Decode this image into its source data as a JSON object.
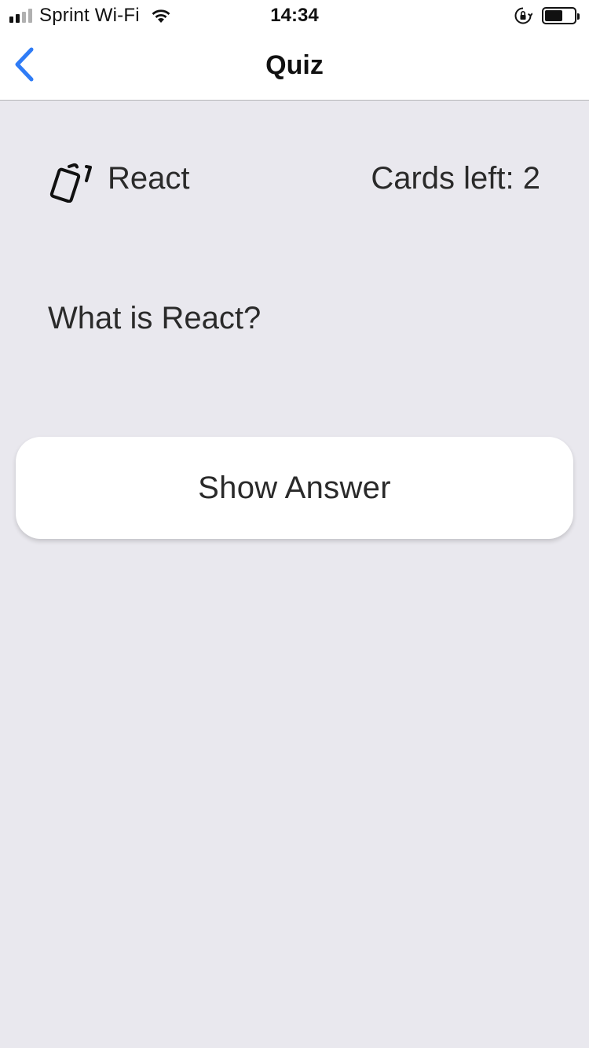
{
  "status_bar": {
    "carrier": "Sprint Wi-Fi",
    "time": "14:34",
    "signal_icon": "signal-bars-icon",
    "wifi_icon": "wifi-icon",
    "rotation_lock_icon": "rotation-lock-icon",
    "battery_icon": "battery-icon",
    "battery_level": 0.65
  },
  "nav": {
    "title": "Quiz",
    "back_icon": "chevron-left-icon",
    "accent_color": "#2f7cf6"
  },
  "deck": {
    "icon": "cards-icon",
    "name": "React",
    "cards_left_label": "Cards left: 2"
  },
  "card": {
    "question": "What is React?"
  },
  "actions": {
    "show_answer_label": "Show Answer"
  },
  "colors": {
    "background": "#e9e8ee",
    "surface": "#ffffff",
    "text": "#2a2a2a"
  }
}
